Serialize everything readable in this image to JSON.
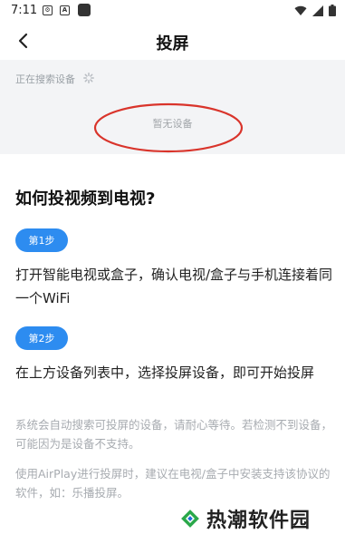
{
  "status": {
    "time": "7:11"
  },
  "header": {
    "title": "投屏",
    "back_icon": "chevron-left-icon"
  },
  "search": {
    "status_text": "正在搜索设备"
  },
  "devices": {
    "empty_text": "暂无设备"
  },
  "guide": {
    "title": "如何投视频到电视?",
    "steps": [
      {
        "badge": "第1步",
        "text": "打开智能电视或盒子，确认电视/盒子与手机连接着同一个WiFi"
      },
      {
        "badge": "第2步",
        "text": "在上方设备列表中，选择投屏设备，即可开始投屏"
      }
    ],
    "hints": [
      "系统会自动搜索可投屏的设备，请耐心等待。若检测不到设备，可能因为是设备不支持。",
      "使用AirPlay进行投屏时，建议在电视/盒子中安装支持该协议的软件，如：乐播投屏。"
    ]
  },
  "watermark": {
    "text": "热潮软件园"
  },
  "colors": {
    "accent": "#2d8cf0",
    "annotation": "#d9342b"
  }
}
